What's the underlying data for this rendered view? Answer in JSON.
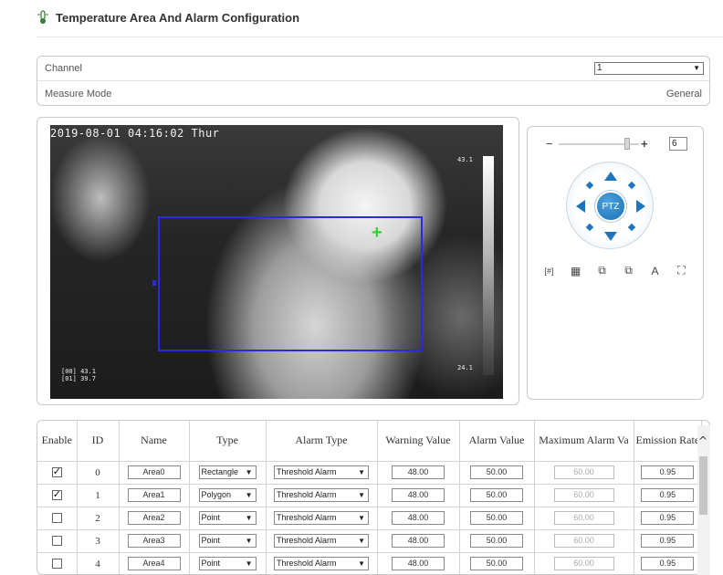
{
  "header": {
    "title": "Temperature Area And Alarm Configuration",
    "icon": "thermometer-icon"
  },
  "config": {
    "channel_label": "Channel",
    "channel_value": "1",
    "measure_mode_label": "Measure Mode",
    "measure_mode_value": "General"
  },
  "video": {
    "osd_datetime": "2019-08-01 04:16:02 Thur",
    "scale_max": "43.1",
    "scale_min": "24.1",
    "legend": "[00] 43.1\n[01] 39.7"
  },
  "ptz": {
    "zoom_minus": "−",
    "zoom_plus": "+",
    "zoom_value": "6",
    "zoom_level_fraction": 0.82,
    "center_label": "PTZ",
    "tools": [
      {
        "name": "zoom-area-icon",
        "glyph": "[#]"
      },
      {
        "name": "grid-icon",
        "glyph": "▦"
      },
      {
        "name": "window-icon",
        "glyph": "⧉"
      },
      {
        "name": "copy-icon",
        "glyph": "⧉"
      },
      {
        "name": "text-icon",
        "glyph": "A"
      },
      {
        "name": "fullscreen-icon",
        "glyph": "⛶"
      }
    ]
  },
  "table": {
    "columns": [
      "Enable",
      "ID",
      "Name",
      "Type",
      "Alarm Type",
      "Warning Value",
      "Alarm Value",
      "Maximum Alarm Va",
      "Emission Rate"
    ],
    "rows": [
      {
        "enable": true,
        "id": "0",
        "name": "Area0",
        "type": "Rectangle",
        "alarm_type": "Threshold Alarm",
        "warning": "48.00",
        "alarm": "50.00",
        "max_alarm": "60.00",
        "emission": "0.95"
      },
      {
        "enable": true,
        "id": "1",
        "name": "Area1",
        "type": "Polygon",
        "alarm_type": "Threshold Alarm",
        "warning": "48.00",
        "alarm": "50.00",
        "max_alarm": "60.00",
        "emission": "0.95"
      },
      {
        "enable": false,
        "id": "2",
        "name": "Area2",
        "type": "Point",
        "alarm_type": "Threshold Alarm",
        "warning": "48.00",
        "alarm": "50.00",
        "max_alarm": "60.00",
        "emission": "0.95"
      },
      {
        "enable": false,
        "id": "3",
        "name": "Area3",
        "type": "Point",
        "alarm_type": "Threshold Alarm",
        "warning": "48.00",
        "alarm": "50.00",
        "max_alarm": "60.00",
        "emission": "0.95"
      },
      {
        "enable": false,
        "id": "4",
        "name": "Area4",
        "type": "Point",
        "alarm_type": "Threshold Alarm",
        "warning": "48.00",
        "alarm": "50.00",
        "max_alarm": "60.00",
        "emission": "0.95"
      }
    ]
  },
  "colors": {
    "accent": "#1f75bd",
    "area_outline": "#2b2bd8",
    "marker": "#2fd32f"
  }
}
